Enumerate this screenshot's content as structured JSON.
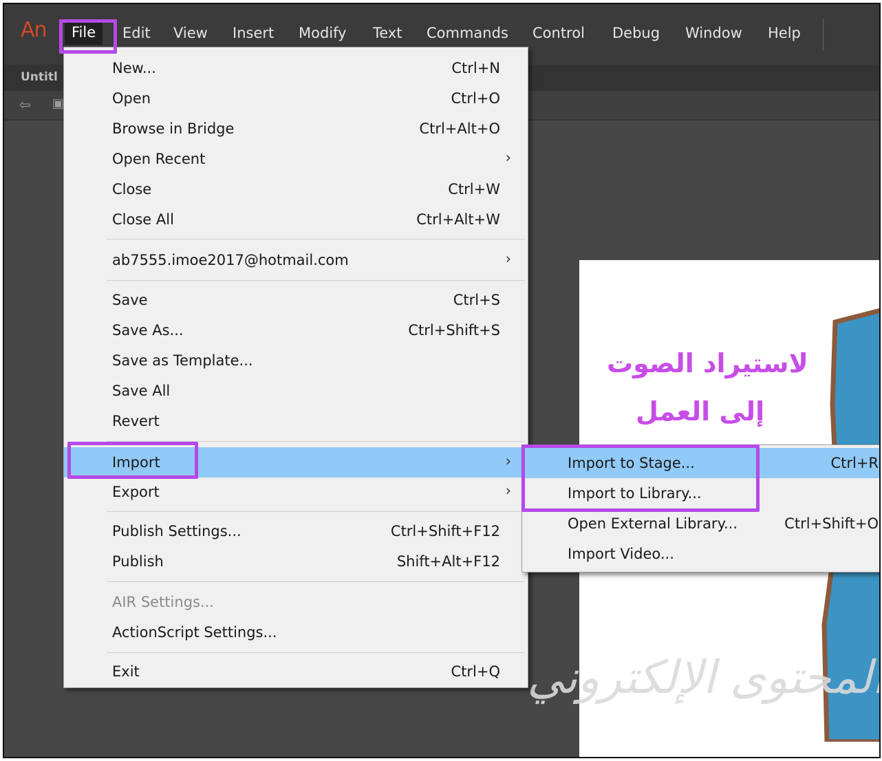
{
  "app": {
    "logo": "An"
  },
  "menubar": {
    "items": [
      "File",
      "Edit",
      "View",
      "Insert",
      "Modify",
      "Text",
      "Commands",
      "Control",
      "Debug",
      "Window",
      "Help"
    ]
  },
  "document": {
    "tab": "Untitl"
  },
  "file_menu": {
    "items": [
      {
        "label": "New...",
        "shortcut": "Ctrl+N"
      },
      {
        "label": "Open",
        "shortcut": "Ctrl+O"
      },
      {
        "label": "Browse in Bridge",
        "shortcut": "Ctrl+Alt+O"
      },
      {
        "label": "Open Recent",
        "shortcut": "",
        "submenu": true
      },
      {
        "label": "Close",
        "shortcut": "Ctrl+W"
      },
      {
        "label": "Close All",
        "shortcut": "Ctrl+Alt+W"
      },
      {
        "label": "ab7555.imoe2017@hotmail.com",
        "shortcut": "",
        "submenu": true
      },
      {
        "label": "Save",
        "shortcut": "Ctrl+S"
      },
      {
        "label": "Save As...",
        "shortcut": "Ctrl+Shift+S"
      },
      {
        "label": "Save as Template...",
        "shortcut": ""
      },
      {
        "label": "Save All",
        "shortcut": ""
      },
      {
        "label": "Revert",
        "shortcut": ""
      },
      {
        "label": "Import",
        "shortcut": "",
        "submenu": true,
        "highlighted": true
      },
      {
        "label": "Export",
        "shortcut": "",
        "submenu": true
      },
      {
        "label": "Publish Settings...",
        "shortcut": "Ctrl+Shift+F12"
      },
      {
        "label": "Publish",
        "shortcut": "Shift+Alt+F12"
      },
      {
        "label": "AIR Settings...",
        "shortcut": "",
        "disabled": true
      },
      {
        "label": "ActionScript Settings...",
        "shortcut": ""
      },
      {
        "label": "Exit",
        "shortcut": "Ctrl+Q"
      }
    ]
  },
  "import_submenu": {
    "items": [
      {
        "label": "Import to Stage...",
        "shortcut": "Ctrl+R",
        "highlighted": true
      },
      {
        "label": "Import to Library...",
        "shortcut": ""
      },
      {
        "label": "Open External Library...",
        "shortcut": "Ctrl+Shift+O"
      },
      {
        "label": "Import Video...",
        "shortcut": ""
      }
    ]
  },
  "stage": {
    "caption_line1": "لاستيراد الصوت",
    "caption_line2": "إلى العمل",
    "watermark": "المحتوى الإلكتروني"
  },
  "colors": {
    "highlight": "#91c9f7",
    "annotation": "#b54ae8",
    "caption": "#c84de8",
    "shape_fill": "#3c94c4",
    "shape_stroke": "#8b5a3c"
  },
  "icons": {
    "back": "back-arrow-icon",
    "scene": "scene-icon",
    "submenu": "chevron-right-icon"
  }
}
